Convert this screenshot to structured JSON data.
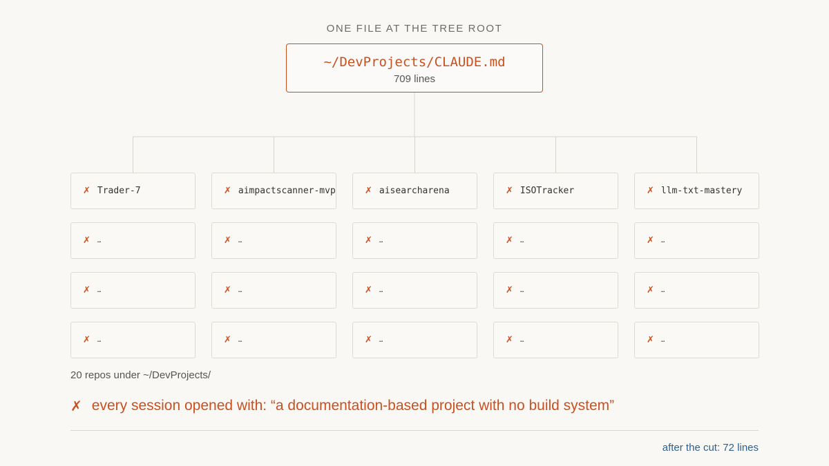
{
  "heading": "ONE FILE AT THE TREE ROOT",
  "root": {
    "path": "~/DevProjects/CLAUDE.md",
    "lines": "709 lines"
  },
  "repo_mark": "✗",
  "repos": [
    [
      "Trader-7",
      "aimpactscanner-mvp",
      "aisearcharena",
      "ISOTracker",
      "llm-txt-mastery"
    ],
    [
      "…",
      "…",
      "…",
      "…",
      "…"
    ],
    [
      "…",
      "…",
      "…",
      "…",
      "…"
    ],
    [
      "…",
      "…",
      "…",
      "…",
      "…"
    ]
  ],
  "caption": "20 repos under ~/DevProjects/",
  "warning": {
    "mark": "✗",
    "text": "every session opened with: “a documentation-based project with no build system”"
  },
  "after_cut": "after the cut: 72 lines",
  "colors": {
    "accent": "#c9501f",
    "box_border": "#dcdad5",
    "connector": "#d5d3ce",
    "after_cut_text": "#2f5f8a",
    "background": "#f9f8f5"
  }
}
